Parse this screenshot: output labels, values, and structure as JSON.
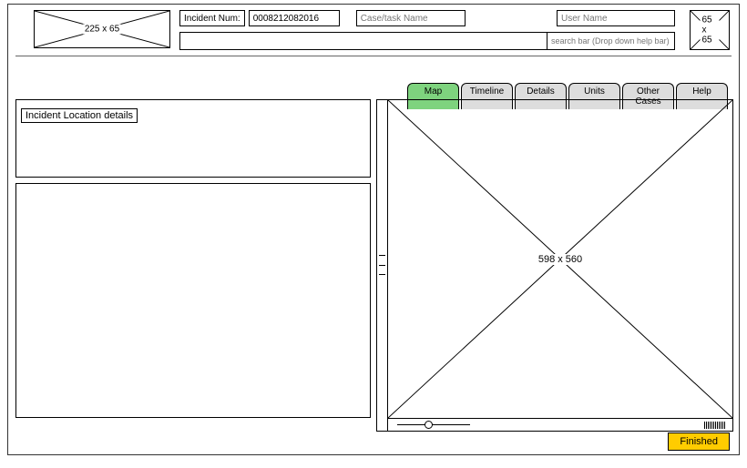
{
  "header": {
    "logo_size_label": "225 x 65",
    "incident_num_label": "Incident Num:",
    "incident_num_value": "0008212082016",
    "case_task_placeholder": "Case/task Name",
    "user_name_placeholder": "User Name",
    "avatar_size_label": "65 x 65",
    "search_placeholder": "search bar (Drop down help bar)"
  },
  "tabs": [
    {
      "label": "Map",
      "active": true
    },
    {
      "label": "Timeline",
      "active": false
    },
    {
      "label": "Details",
      "active": false
    },
    {
      "label": "Units",
      "active": false
    },
    {
      "label": "Other Cases",
      "active": false
    },
    {
      "label": "Help",
      "active": false
    }
  ],
  "left_panel": {
    "location_label": "Incident Location details"
  },
  "map": {
    "size_label": "598 x 560"
  },
  "footer": {
    "finished_label": "Finished"
  }
}
